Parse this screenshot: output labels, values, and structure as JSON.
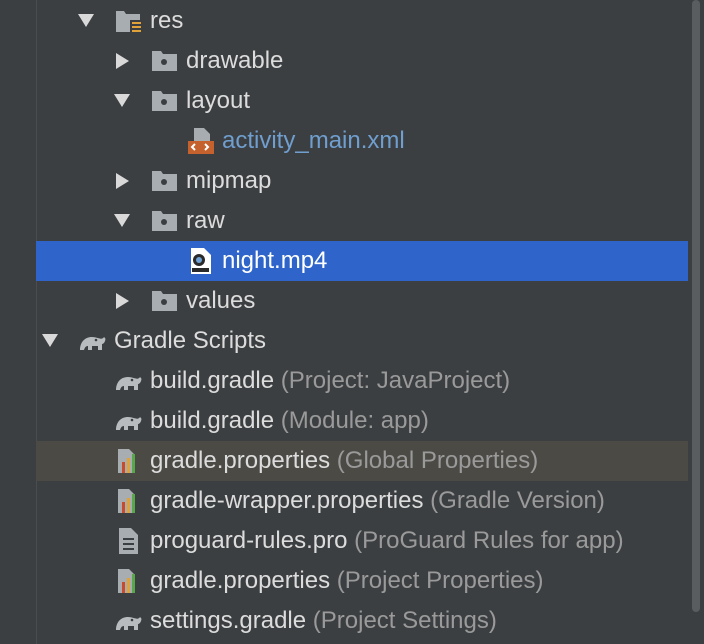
{
  "tree": {
    "rows": [
      {
        "label": "res",
        "hint": "",
        "expanded": true,
        "icon": "resource-folder-icon"
      },
      {
        "label": "drawable",
        "hint": "",
        "expanded": false,
        "icon": "folder-icon"
      },
      {
        "label": "layout",
        "hint": "",
        "expanded": true,
        "icon": "folder-icon"
      },
      {
        "label": "activity_main.xml",
        "hint": "",
        "icon": "xml-file-icon"
      },
      {
        "label": "mipmap",
        "hint": "",
        "expanded": false,
        "icon": "folder-icon"
      },
      {
        "label": "raw",
        "hint": "",
        "expanded": true,
        "icon": "folder-icon"
      },
      {
        "label": "night.mp4",
        "hint": "",
        "icon": "video-file-icon",
        "selected": true
      },
      {
        "label": "values",
        "hint": "",
        "expanded": false,
        "icon": "folder-icon"
      },
      {
        "label": "Gradle Scripts",
        "hint": "",
        "expanded": true,
        "icon": "gradle-elephant-icon"
      },
      {
        "label": "build.gradle",
        "hint": "(Project: JavaProject)",
        "icon": "gradle-elephant-icon"
      },
      {
        "label": "build.gradle",
        "hint": "(Module: app)",
        "icon": "gradle-elephant-icon"
      },
      {
        "label": "gradle.properties",
        "hint": "(Global Properties)",
        "icon": "properties-file-icon",
        "hover": true
      },
      {
        "label": "gradle-wrapper.properties",
        "hint": "(Gradle Version)",
        "icon": "properties-file-icon"
      },
      {
        "label": "proguard-rules.pro",
        "hint": "(ProGuard Rules for app)",
        "icon": "text-file-icon"
      },
      {
        "label": "gradle.properties",
        "hint": "(Project Properties)",
        "icon": "properties-file-icon"
      },
      {
        "label": "settings.gradle",
        "hint": "(Project Settings)",
        "icon": "gradle-elephant-icon"
      }
    ]
  },
  "colors": {
    "background": "#3c3f41",
    "selection": "#2f65ca",
    "hover": "#4b4a45",
    "text": "#dcdcdc",
    "hint": "#9a9a9a",
    "link": "#6f9ecf"
  }
}
